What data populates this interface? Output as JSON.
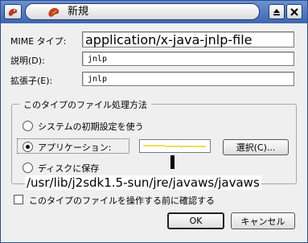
{
  "window": {
    "title": "新規"
  },
  "fields": {
    "mime_label": "MIME タイプ:",
    "mime_value": "application/x-java-jnlp-file",
    "description_label": "説明(D):",
    "description_value": "jnlp",
    "extension_label": "拡張子(E):",
    "extension_value": "jnlp"
  },
  "handling": {
    "group_title": "このタイプのファイル処理方法",
    "option_default": "システムの初期設定を使う",
    "option_application": "アプリケーション:",
    "option_save": "ディスクに保存",
    "select_button": "選択(C)...",
    "selected": "application",
    "application_path": "/usr/lib/j2sdk1.5-sun/jre/javaws/javaws"
  },
  "confirm": {
    "label": "このタイプのファイルを操作する前に確認する",
    "checked": false
  },
  "buttons": {
    "ok": "OK",
    "cancel": "キャンセル"
  },
  "icons": {
    "window_menu": "app-menu-icon",
    "app_title": "firefox-app-icon",
    "shade": "shade-up-icon",
    "close": "close-icon"
  },
  "colors": {
    "titlebar": "#3c66b2",
    "window_bg": "#efefef",
    "preview_line": "#e7d21a"
  }
}
